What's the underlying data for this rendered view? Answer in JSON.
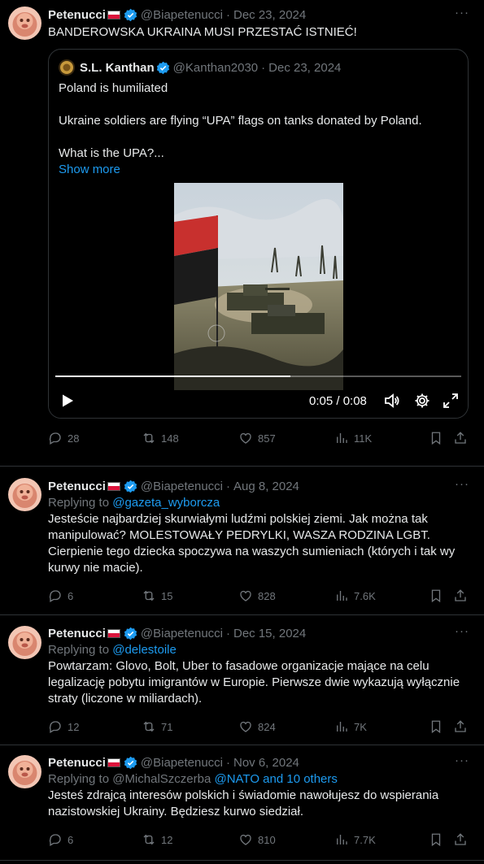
{
  "tweets": [
    {
      "name": "Petenucci",
      "handle": "@Biapetenucci",
      "date": "Dec 23, 2024",
      "more": "···",
      "text": "BANDEROWSKA UKRAINA MUSI PRZESTAĆ ISTNIEĆ!",
      "quote": {
        "name": "S.L. Kanthan",
        "handle": "@Kanthan2030",
        "date": "Dec 23, 2024",
        "lines": [
          "Poland is humiliated",
          "",
          "Ukraine soldiers are flying “UPA” flags on tanks donated by Poland.",
          "",
          "What is the UPA?..."
        ],
        "show_more": "Show more",
        "video": {
          "time": "0:05 / 0:08",
          "progress": 0.58
        }
      },
      "replies": "28",
      "reposts": "148",
      "likes": "857",
      "views": "11K"
    },
    {
      "name": "Petenucci",
      "handle": "@Biapetenucci",
      "date": "Aug 8, 2024",
      "more": "···",
      "replying_prefix": "Replying to ",
      "replying_to": "@gazeta_wyborcza",
      "lines": [
        "Jesteście najbardziej skurwiałymi ludźmi polskiej ziemi. Jak można tak",
        "manipulować? MOLESTOWAŁY PEDRYLKI, WASZA RODZINA LGBT.",
        "Cierpienie tego dziecka spoczywa na waszych sumieniach (których i tak wy",
        "kurwy nie macie)."
      ],
      "replies": "6",
      "reposts": "15",
      "likes": "828",
      "views": "7.6K"
    },
    {
      "name": "Petenucci",
      "handle": "@Biapetenucci",
      "date": "Dec 15, 2024",
      "more": "···",
      "replying_prefix": "Replying to ",
      "replying_to": "@delestoile",
      "lines": [
        "Powtarzam: Glovo, Bolt, Uber to fasadowe organizacje mające na celu",
        "legalizację pobytu imigrantów w Europie. Pierwsze dwie wykazują wyłącznie",
        "straty (liczone w miliardach)."
      ],
      "replies": "12",
      "reposts": "71",
      "likes": "824",
      "views": "7K"
    },
    {
      "name": "Petenucci",
      "handle": "@Biapetenucci",
      "date": "Nov 6, 2024",
      "more": "···",
      "replying_prefix": "Replying to @MichalSzczerba ",
      "replying_to": "@NATO and 10 others",
      "lines": [
        "Jesteś zdrajcą interesów polskich i świadomie nawołujesz do wspierania",
        "nazistowskiej Ukrainy. Będziesz kurwo siedział."
      ],
      "replies": "6",
      "reposts": "12",
      "likes": "810",
      "views": "7.7K"
    }
  ],
  "icons": [
    "reply-icon",
    "repost-icon",
    "like-icon",
    "views-icon",
    "bookmark-icon",
    "share-icon",
    "play-icon",
    "volume-icon",
    "settings-icon",
    "fullscreen-icon"
  ],
  "colors": {
    "background": "#000000",
    "text": "#e7e9ea",
    "muted": "#71767b",
    "link": "#1d9bf0",
    "border": "#2f3336"
  }
}
